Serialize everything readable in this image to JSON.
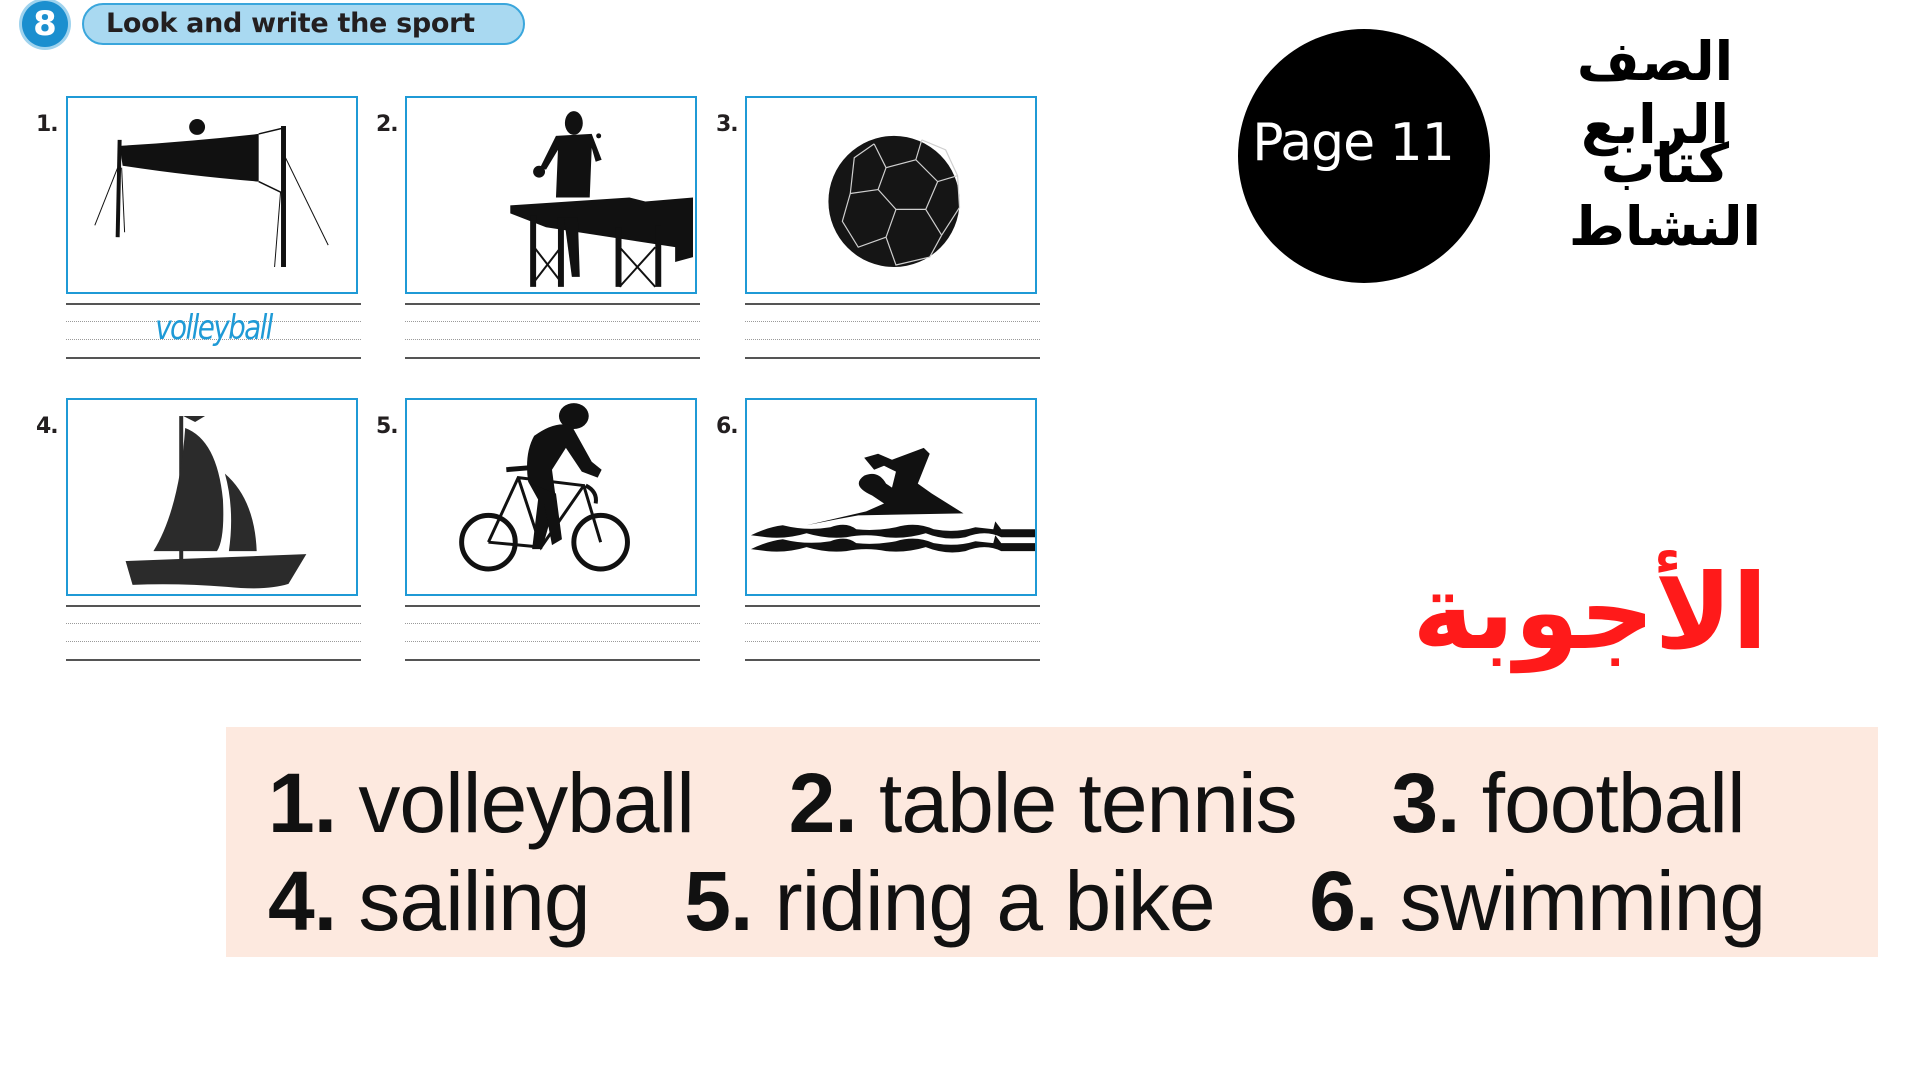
{
  "exercise": {
    "number": "8",
    "title": "Look and write the sport"
  },
  "items": [
    {
      "number": "1.",
      "sport_icon": "volleyball-net-icon",
      "written_answer": "volleyball"
    },
    {
      "number": "2.",
      "sport_icon": "table-tennis-player-icon",
      "written_answer": ""
    },
    {
      "number": "3.",
      "sport_icon": "football-ball-icon",
      "written_answer": ""
    },
    {
      "number": "4.",
      "sport_icon": "sailboat-icon",
      "written_answer": ""
    },
    {
      "number": "5.",
      "sport_icon": "cyclist-icon",
      "written_answer": ""
    },
    {
      "number": "6.",
      "sport_icon": "swimmer-icon",
      "written_answer": ""
    }
  ],
  "header_right": {
    "page_label": "Page 11",
    "grade": "الصف الرابع",
    "book": "كتاب النشاط"
  },
  "answers_title": "الأجوبة",
  "answer_key": {
    "row1": [
      {
        "n": "1.",
        "text": "volleyball"
      },
      {
        "n": "2.",
        "text": "table tennis"
      },
      {
        "n": "3.",
        "text": "football"
      }
    ],
    "row2": [
      {
        "n": "4.",
        "text": "sailing"
      },
      {
        "n": "5.",
        "text": "riding a bike"
      },
      {
        "n": "6.",
        "text": "swimming"
      }
    ]
  },
  "colors": {
    "box_border": "#1f9ad6",
    "handwriting": "#1f9ad6",
    "answers_title": "#ff1a1a",
    "answer_box_bg": "#fde9df",
    "page_circle": "#000000"
  }
}
